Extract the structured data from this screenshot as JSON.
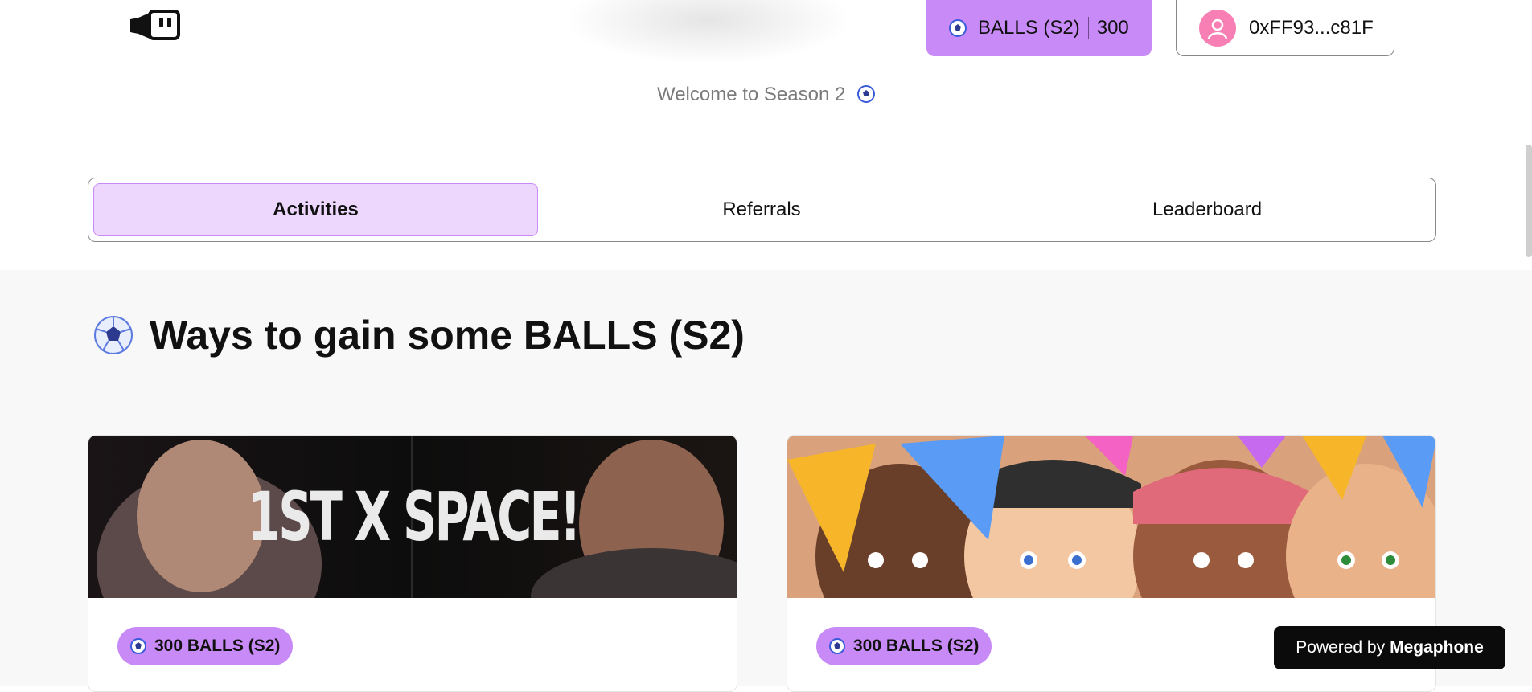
{
  "header": {
    "balls_label": "BALLS (S2)",
    "balls_count": "300",
    "wallet_address": "0xFF93...c81F"
  },
  "welcome_text": "Welcome to Season 2",
  "tabs": [
    {
      "label": "Activities",
      "active": true
    },
    {
      "label": "Referrals",
      "active": false
    },
    {
      "label": "Leaderboard",
      "active": false
    }
  ],
  "section": {
    "title": "Ways to gain some BALLS (S2)"
  },
  "cards": [
    {
      "banner_text": "1ST X SPACE!",
      "reward": "300 BALLS (S2)"
    },
    {
      "banner_text": "",
      "reward": "300 BALLS (S2)"
    }
  ],
  "powered_by": {
    "prefix": "Powered by",
    "brand": "Megaphone"
  },
  "colors": {
    "accent": "#c88af7",
    "accent_light": "#eed7fd",
    "dark": "#0b0b0b",
    "avatar": "#f77fb3"
  },
  "icons": [
    "megaphone-logo-icon",
    "soccer-ball-icon",
    "user-avatar-icon"
  ]
}
